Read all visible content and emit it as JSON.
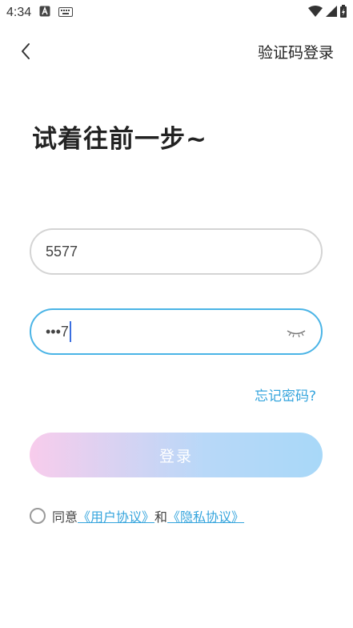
{
  "status_bar": {
    "time": "4:34"
  },
  "header": {
    "sms_login": "验证码登录"
  },
  "title": "试着往前一步~",
  "account": {
    "value": "5577"
  },
  "password": {
    "value": "•••7"
  },
  "forgot_password": "忘记密码?",
  "login_button": "登录",
  "agreement": {
    "prefix": "同意",
    "user_agreement": "《用户协议》",
    "and": "和",
    "privacy_policy": "《隐私协议》"
  },
  "colors": {
    "accent": "#36a5dd",
    "focus_border": "#4ab4e6"
  }
}
